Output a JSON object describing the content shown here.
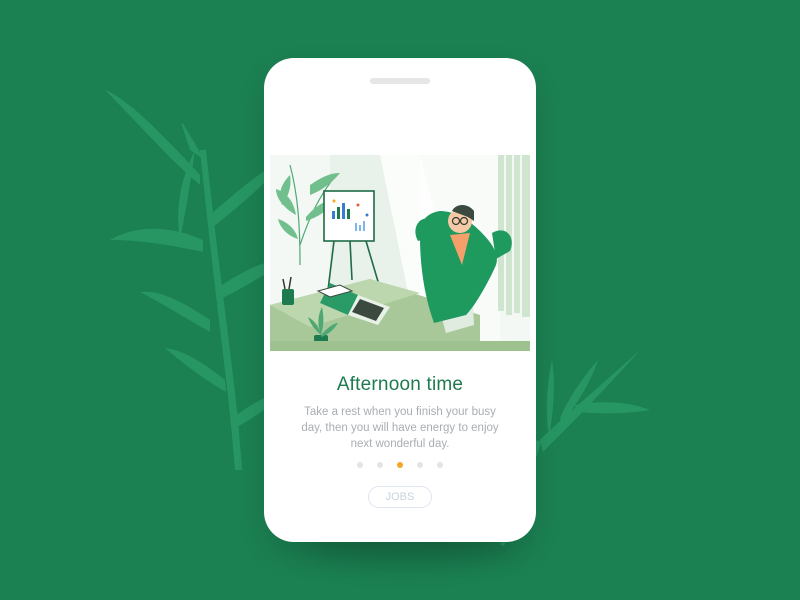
{
  "onboarding": {
    "title": "Afternoon time",
    "description": "Take a rest when you finish your busy day, then you will have energy to enjoy next wonderful day.",
    "pagination": {
      "total": 5,
      "active_index": 2
    },
    "button_label": "JOBS"
  },
  "colors": {
    "background": "#1b8052",
    "accent_title": "#1e7a4f",
    "active_dot": "#f5a623",
    "inactive_dot": "#e2e4e6"
  },
  "illustration": {
    "icon": "office-relax-illustration"
  }
}
